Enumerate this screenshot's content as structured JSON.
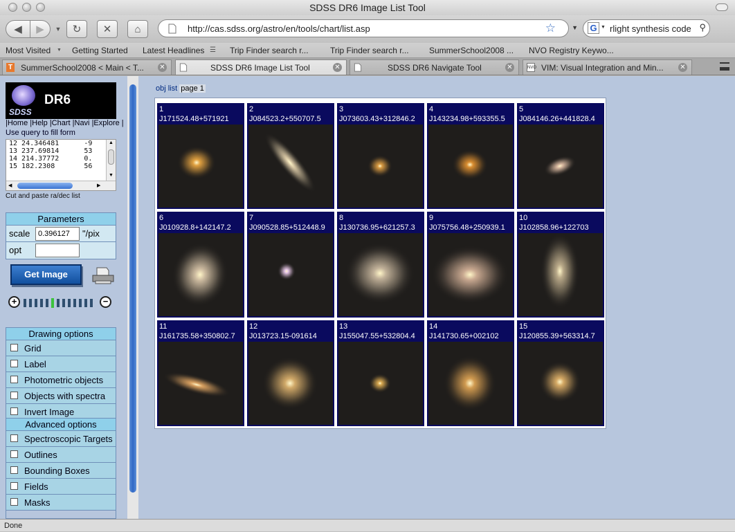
{
  "window": {
    "title": "SDSS DR6 Image List Tool"
  },
  "toolbar": {
    "url": "http://cas.sdss.org/astro/en/tools/chart/list.asp",
    "search_value": "rlight synthesis code"
  },
  "bookmarks": [
    "Most Visited",
    "Getting Started",
    "Latest Headlines",
    "Trip Finder search r...",
    "Trip Finder search r...",
    "SummerSchool2008 ...",
    "NVO Registry Keywo..."
  ],
  "tabs": [
    {
      "label": "SummerSchool2008 < Main < T...",
      "active": false
    },
    {
      "label": "SDSS DR6 Image List Tool",
      "active": true
    },
    {
      "label": "SDSS DR6 Navigate Tool",
      "active": false
    },
    {
      "label": "VIM: Visual Integration and Min...",
      "active": false
    }
  ],
  "sidebar": {
    "logo_text": "DR6",
    "logo_sub": "SDSS",
    "nav": [
      "|Home",
      "|Help",
      "|Chart",
      "|Navi",
      "|Explore",
      "|"
    ],
    "use_query": "Use query to fill form",
    "radec_lines": [
      "12 24.346481      -9",
      "13 237.69814      53",
      "14 214.37772      0.",
      "15 182.2308       56"
    ],
    "cut_paste": "Cut and paste ra/dec list",
    "params_title": "Parameters",
    "scale_label": "scale",
    "scale_value": "0.396127",
    "scale_unit": "\"/pix",
    "opt_label": "opt",
    "opt_value": "",
    "get_image": "Get Image",
    "drawing_title": "Drawing options",
    "drawing_options": [
      "Grid",
      "Label",
      "Photometric objects",
      "Objects with spectra",
      "Invert Image"
    ],
    "advanced_title": "Advanced options",
    "advanced_options": [
      "Spectroscopic Targets",
      "Outlines",
      "Bounding Boxes",
      "Fields",
      "Masks"
    ]
  },
  "main": {
    "obj_list": "obj list",
    "page": "page 1",
    "objects": [
      {
        "n": "1",
        "name": "J171524.48+571921"
      },
      {
        "n": "2",
        "name": "J084523.2+550707.5"
      },
      {
        "n": "3",
        "name": "J073603.43+312846.2"
      },
      {
        "n": "4",
        "name": "J143234.98+593355.5"
      },
      {
        "n": "5",
        "name": "J084146.26+441828.4"
      },
      {
        "n": "6",
        "name": "J010928.8+142147.2"
      },
      {
        "n": "7",
        "name": "J090528.85+512448.9"
      },
      {
        "n": "8",
        "name": "J130736.95+621257.3"
      },
      {
        "n": "9",
        "name": "J075756.48+250939.1"
      },
      {
        "n": "10",
        "name": "J102858.96+122703"
      },
      {
        "n": "11",
        "name": "J161735.58+350802.7"
      },
      {
        "n": "12",
        "name": "J013723.15-091614"
      },
      {
        "n": "13",
        "name": "J155047.55+532804.4"
      },
      {
        "n": "14",
        "name": "J141730.65+002102"
      },
      {
        "n": "15",
        "name": "J120855.39+563314.7"
      }
    ]
  },
  "status": {
    "text": "Done"
  },
  "colors": {
    "page_bg": "#b7c6dd",
    "cell_bg": "#0a0a5e",
    "panel_header": "#8fd0ea",
    "button": "#1f5fb4"
  }
}
